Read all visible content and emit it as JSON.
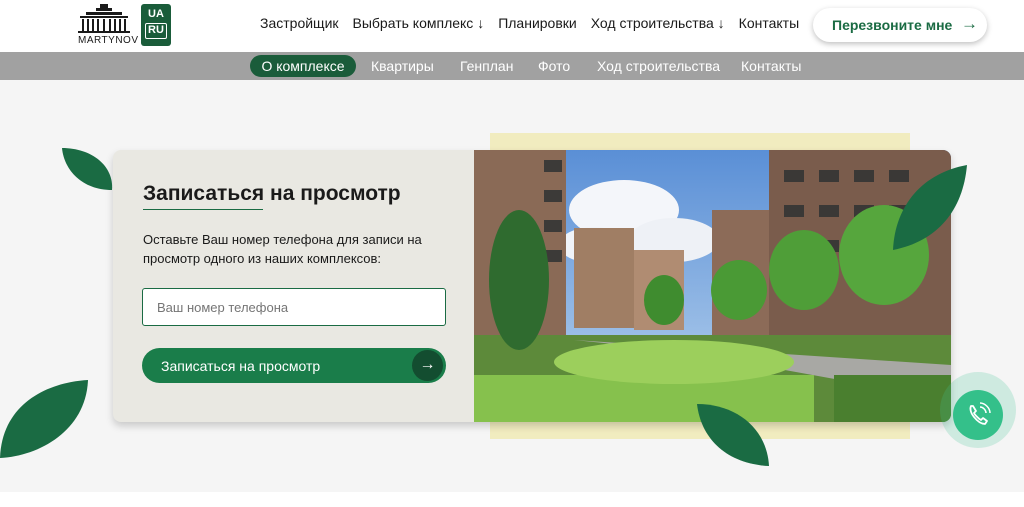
{
  "brand": {
    "logo_text": "MARTYNOV",
    "lang_active": "UA",
    "lang_other": "RU"
  },
  "topnav": {
    "items": [
      "Застройщик",
      "Выбрать комплекс ↓",
      "Планировки",
      "Ход строительства ↓",
      "Контакты"
    ]
  },
  "callback_button": {
    "label": "Перезвоните мне",
    "icon": "arrow-right-icon"
  },
  "subnav": {
    "active": "О комплексе",
    "items": [
      "Квартиры",
      "Генплан",
      "Фото",
      "Ход строительства",
      "Контакты"
    ]
  },
  "form": {
    "title": "Записаться на просмотр",
    "description": "Оставьте Ваш номер телефона для записи на просмотр одного из наших комплексов:",
    "phone_placeholder": "Ваш номер телефона",
    "submit_label": "Записаться на просмотр"
  },
  "fab": {
    "icon": "phone-icon"
  },
  "colors": {
    "brand_green": "#1a5c3a",
    "button_green": "#1a7d4a",
    "fab_green": "#34c08a",
    "subnav_gray": "#a1a1a1"
  }
}
